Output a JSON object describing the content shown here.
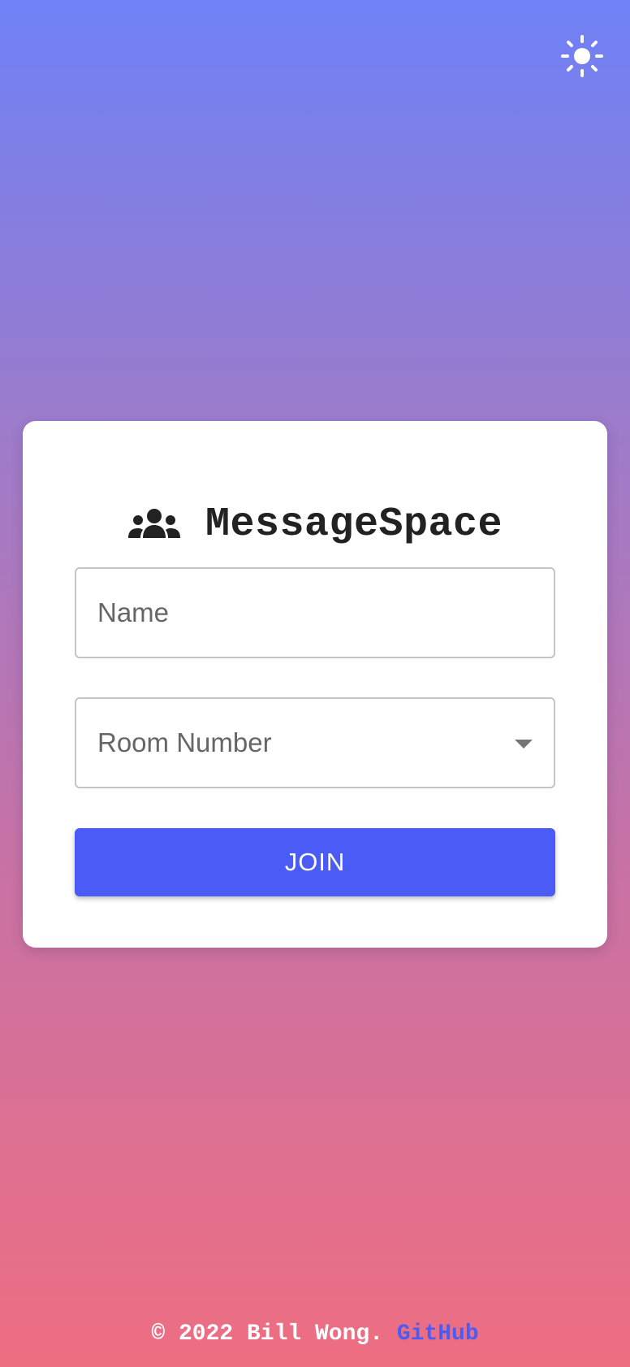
{
  "header": {
    "theme_toggle_icon": "sun-icon"
  },
  "card": {
    "brand_icon": "users-group-icon",
    "title": "MessageSpace",
    "name_field": {
      "placeholder": "Name",
      "value": ""
    },
    "room_select": {
      "placeholder": "Room Number",
      "value": ""
    },
    "join_label": "JOIN"
  },
  "footer": {
    "text": "© 2022 Bill Wong. ",
    "link_label": "GitHub"
  },
  "colors": {
    "accent": "#4a5cf5",
    "gradient_top": "#6e81f6",
    "gradient_bottom": "#ee6e81"
  }
}
